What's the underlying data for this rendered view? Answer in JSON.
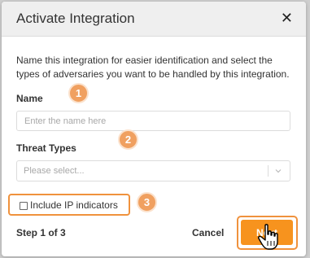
{
  "dialog": {
    "title": "Activate Integration",
    "close_icon": "close-icon",
    "description": "Name this integration for easier identification and select the types of adversaries you want to be handled by this integration."
  },
  "form": {
    "name_label": "Name",
    "name_placeholder": "Enter the name here",
    "threat_types_label": "Threat Types",
    "threat_types_placeholder": "Please select...",
    "include_ip_label": "Include IP indicators",
    "include_ip_checked": false
  },
  "footer": {
    "step_text": "Step 1 of 3",
    "cancel_label": "Cancel",
    "next_label": "Next"
  },
  "annotations": {
    "badge_1": "1",
    "badge_2": "2",
    "badge_3": "3"
  },
  "colors": {
    "accent": "#f7931e",
    "highlight": "#f0923d",
    "badge": "#f0a060"
  }
}
